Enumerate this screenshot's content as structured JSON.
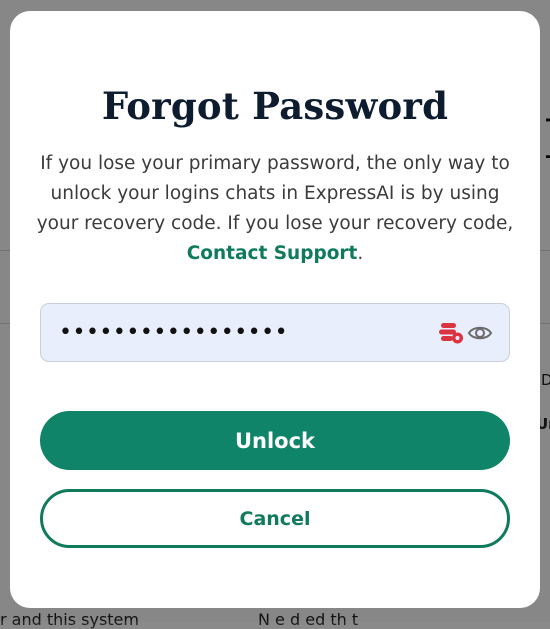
{
  "background": {
    "big_letter": "I",
    "side_text_1": "D",
    "side_text_2": "Ur",
    "bottom_left": "r and this system",
    "bottom_right": "N      e d     ed th     t"
  },
  "modal": {
    "title": "Forgot Password",
    "description": "If you lose your primary password, the only way to unlock your logins chats in ExpressAI is by using your recovery code. If you lose your recovery code,",
    "support_link": "Contact Support",
    "period": ".",
    "password_value": "•••••••••••••••••",
    "unlock_label": "Unlock",
    "cancel_label": "Cancel"
  },
  "colors": {
    "accent": "#0f8468",
    "link": "#0f7a5c",
    "field_bg": "#e8eefb",
    "title": "#0d1c2e",
    "key_icon": "#d9343f"
  },
  "icons": {
    "password_manager": "key-stack-icon",
    "show_password": "eye-icon"
  }
}
